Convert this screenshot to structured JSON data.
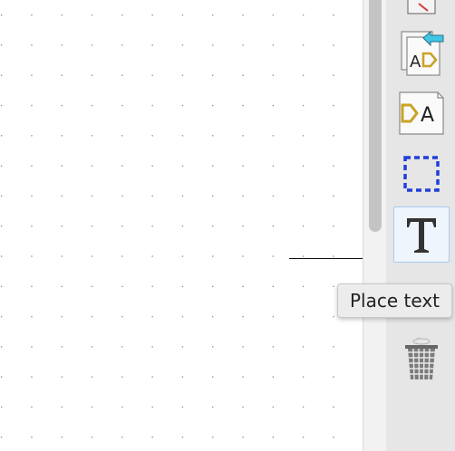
{
  "toolbar": {
    "tools": [
      {
        "name": "partial-tool-icon"
      },
      {
        "name": "import-sheet-pin-icon"
      },
      {
        "name": "hierarchical-label-icon"
      },
      {
        "name": "rectangle-select-icon"
      },
      {
        "name": "text-icon",
        "active": true
      },
      {
        "name": "partial-tool-icon"
      },
      {
        "name": "trash-icon"
      }
    ],
    "tooltip": "Place text"
  },
  "colors": {
    "accent_yellow": "#c9a227",
    "arrow_cyan": "#3fc7e6",
    "select_blue": "#1f3fd8",
    "active_bg": "#eef5fd",
    "active_border": "#a9c9ee"
  }
}
